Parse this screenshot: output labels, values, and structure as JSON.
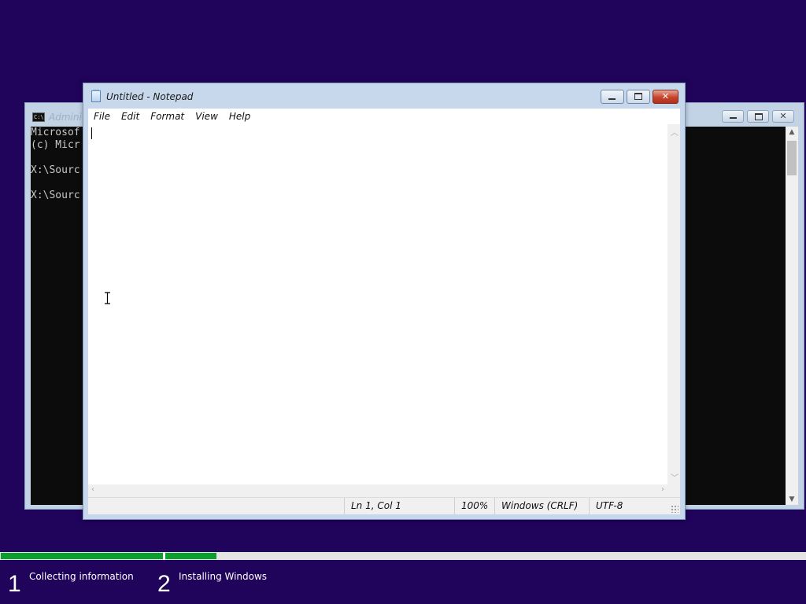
{
  "background_window": {
    "title": "Administrator: X:\\windows\\system32\\cmd.exe",
    "title_visible": "Admini",
    "console_lines": [
      "Microsof",
      "(c) Micr",
      "",
      "X:\\Sourc",
      "",
      "X:\\Sourc"
    ],
    "icons": {
      "app": "console-icon",
      "minimize": "minimize-icon",
      "maximize": "maximize-icon",
      "close": "close-icon"
    }
  },
  "notepad": {
    "title": "Untitled - Notepad",
    "menu": [
      "File",
      "Edit",
      "Format",
      "View",
      "Help"
    ],
    "content": "",
    "status": {
      "position": "Ln 1, Col 1",
      "zoom": "100%",
      "line_ending": "Windows (CRLF)",
      "encoding": "UTF-8"
    },
    "icons": {
      "app": "notepad-icon",
      "minimize": "minimize-icon",
      "maximize": "maximize-icon",
      "close": "close-icon"
    }
  },
  "setup": {
    "steps": [
      {
        "number": "1",
        "label": "Collecting information",
        "progress": 1.0
      },
      {
        "number": "2",
        "label": "Installing Windows",
        "progress": 0.08
      }
    ],
    "colors": {
      "background": "#20035a",
      "progress": "#0ba02c",
      "track": "#e4e4e4"
    }
  }
}
